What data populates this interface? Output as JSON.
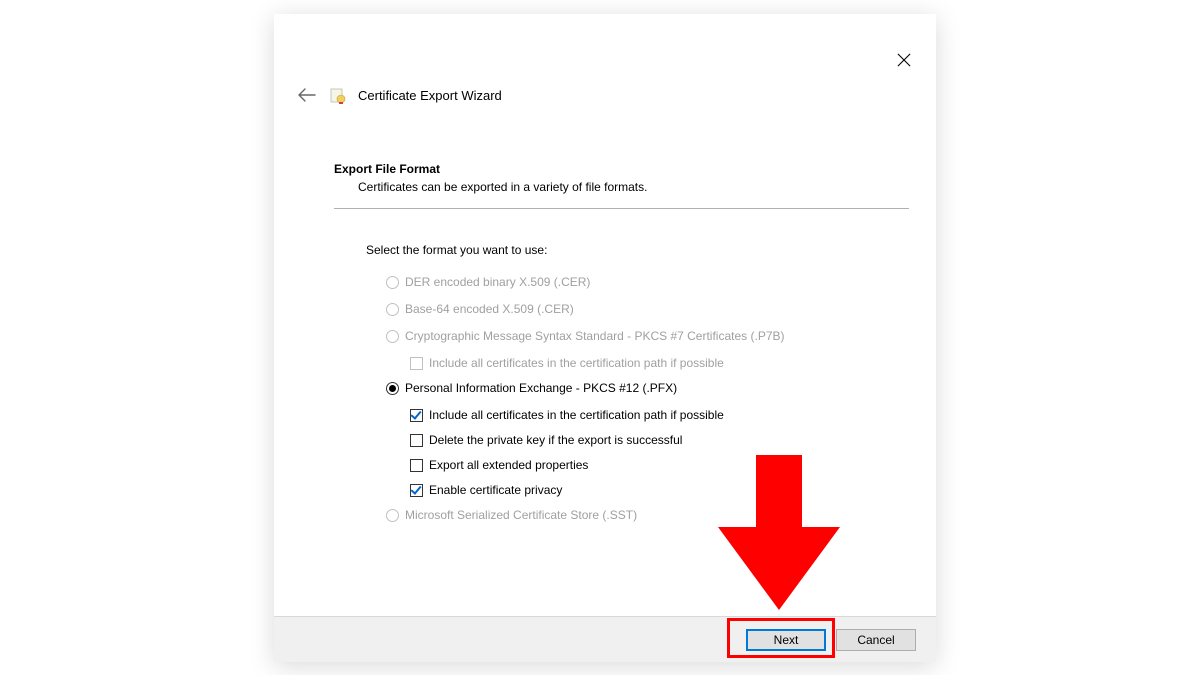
{
  "window": {
    "title": "Certificate Export Wizard"
  },
  "content": {
    "section_title": "Export File Format",
    "section_desc": "Certificates can be exported in a variety of file formats.",
    "select_prompt": "Select the format you want to use:"
  },
  "options": {
    "der": {
      "label": "DER encoded binary X.509 (.CER)",
      "enabled": false,
      "checked": false
    },
    "base64": {
      "label": "Base-64 encoded X.509 (.CER)",
      "enabled": false,
      "checked": false
    },
    "pkcs7": {
      "label": "Cryptographic Message Syntax Standard - PKCS #7 Certificates (.P7B)",
      "enabled": false,
      "checked": false,
      "sub_include": {
        "label": "Include all certificates in the certification path if possible",
        "enabled": false,
        "checked": false
      }
    },
    "pfx": {
      "label": "Personal Information Exchange - PKCS #12 (.PFX)",
      "enabled": true,
      "checked": true,
      "sub_include": {
        "label": "Include all certificates in the certification path if possible",
        "enabled": true,
        "checked": true
      },
      "sub_delete": {
        "label": "Delete the private key if the export is successful",
        "enabled": true,
        "checked": false
      },
      "sub_export_ext": {
        "label": "Export all extended properties",
        "enabled": true,
        "checked": false
      },
      "sub_privacy": {
        "label": "Enable certificate privacy",
        "enabled": true,
        "checked": true
      }
    },
    "sst": {
      "label": "Microsoft Serialized Certificate Store (.SST)",
      "enabled": false,
      "checked": false
    }
  },
  "footer": {
    "next_label": "Next",
    "cancel_label": "Cancel"
  },
  "annotation": {
    "arrow_color": "#ff0000",
    "highlight_color": "#ff0000"
  }
}
